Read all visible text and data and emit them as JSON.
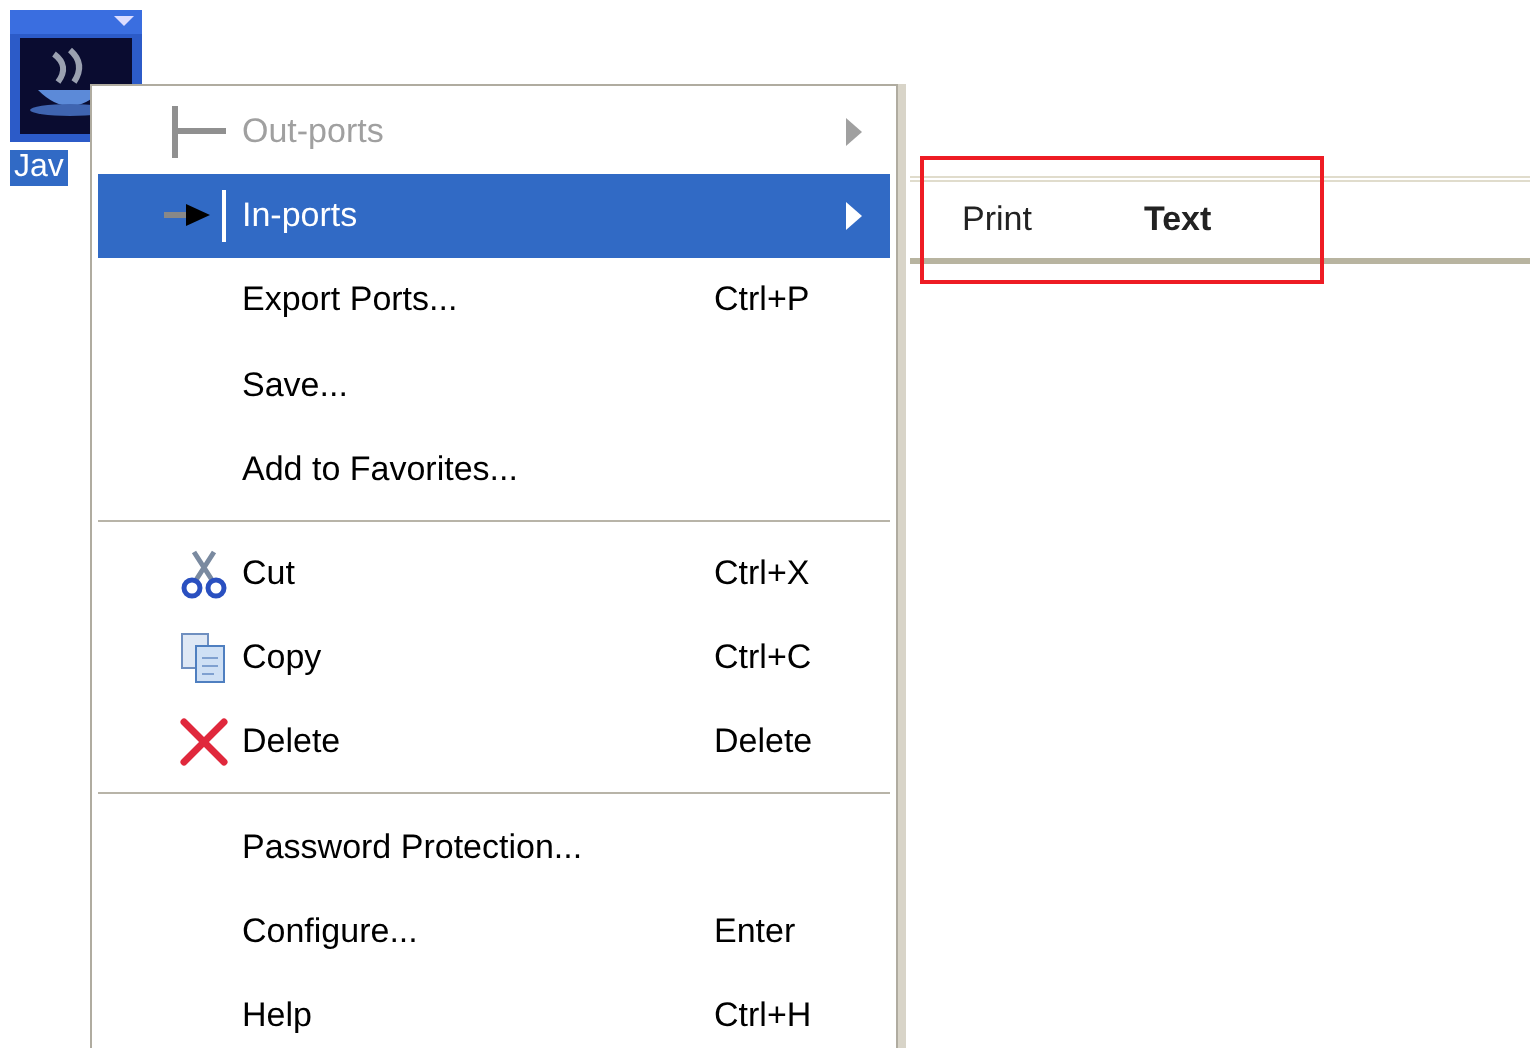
{
  "desktop_icon": {
    "label": "Jav",
    "selected": true
  },
  "context_menu": {
    "items": [
      {
        "kind": "port-out",
        "label": "Out-ports",
        "disabled": true,
        "selected": false,
        "submenu": true
      },
      {
        "kind": "port-in",
        "label": "In-ports",
        "disabled": false,
        "selected": true,
        "submenu": true
      },
      {
        "kind": "plain",
        "label": "Export Ports...",
        "shortcut": "Ctrl+P",
        "disabled": false,
        "selected": false,
        "submenu": false
      },
      {
        "kind": "plain",
        "label": "Save...",
        "disabled": false,
        "selected": false,
        "submenu": false
      },
      {
        "kind": "plain",
        "label": "Add to Favorites...",
        "disabled": false,
        "selected": false,
        "submenu": false
      },
      {
        "kind": "separator"
      },
      {
        "kind": "cut",
        "label": "Cut",
        "shortcut": "Ctrl+X",
        "disabled": false,
        "selected": false,
        "submenu": false
      },
      {
        "kind": "copy",
        "label": "Copy",
        "shortcut": "Ctrl+C",
        "disabled": false,
        "selected": false,
        "submenu": false
      },
      {
        "kind": "delete",
        "label": "Delete",
        "shortcut": "Delete",
        "disabled": false,
        "selected": false,
        "submenu": false
      },
      {
        "kind": "separator"
      },
      {
        "kind": "plain",
        "label": "Password Protection...",
        "disabled": false,
        "selected": false,
        "submenu": false
      },
      {
        "kind": "plain",
        "label": "Configure...",
        "shortcut": "Enter",
        "disabled": false,
        "selected": false,
        "submenu": false
      },
      {
        "kind": "plain",
        "label": "Help",
        "shortcut": "Ctrl+H",
        "disabled": false,
        "selected": false,
        "submenu": false
      }
    ]
  },
  "submenu": {
    "items": [
      {
        "label": "Print",
        "default": false
      },
      {
        "label": "Text",
        "default": true
      }
    ]
  }
}
